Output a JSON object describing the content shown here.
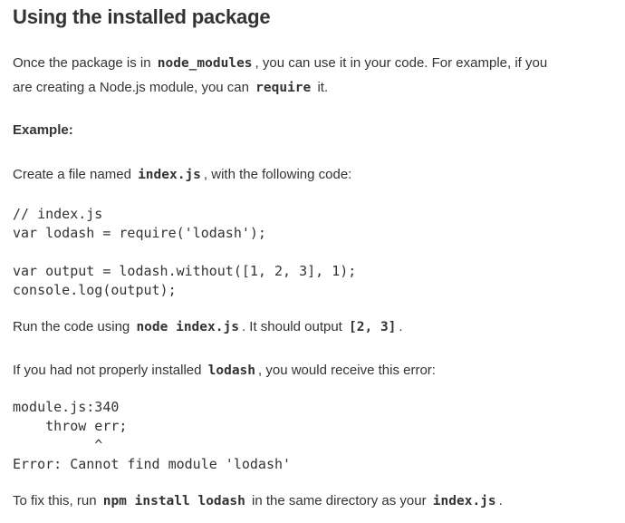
{
  "heading": "Using the installed package",
  "intro": {
    "line1_before": "Once the package is in",
    "line1_code": "node_modules",
    "line1_after": ", you can use it in your code. For example, if you",
    "line2_before": "are creating a Node.js module, you can",
    "line2_code": "require",
    "line2_after": "it."
  },
  "example_label": "Example:",
  "create_file": {
    "before": "Create a file named",
    "code": "index.js",
    "after": ", with the following code:"
  },
  "code_sample": {
    "line1": "// index.js",
    "line2": "var lodash = require('lodash');",
    "line3": "var output = lodash.without([1, 2, 3], 1);",
    "line4": "console.log(output);"
  },
  "run_code": {
    "before": "Run the code using",
    "code": "node index.js",
    "middle": ". It should output",
    "output_code": "[2, 3]",
    "after": "."
  },
  "error_intro": {
    "before": "If you had not properly installed",
    "code": "lodash",
    "after": ", you would receive this error:"
  },
  "error_sample": {
    "line1": "module.js:340",
    "line2": "    throw err;",
    "line3": "          ^",
    "line4": "Error: Cannot find module 'lodash'"
  },
  "fix": {
    "before": "To fix this, run",
    "code1": "npm install lodash",
    "middle": "in the same directory as your",
    "code2": "index.js",
    "after": "."
  }
}
